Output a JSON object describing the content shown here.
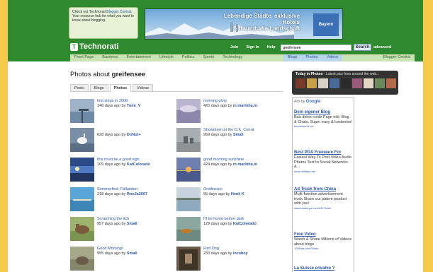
{
  "promo": {
    "pre": "Check out Technorati ",
    "link": "Blogger Central",
    "post": ", Your resource hub for what you want to know about blogging."
  },
  "ad_banner": {
    "line1": "Lebendige Städte, exklusive Hotels",
    "line2": "& traumhafte Landschaft",
    "logo": "Bayern"
  },
  "nav": {
    "logo": "Technorati",
    "links": [
      "Join",
      "Sign In",
      "Help"
    ],
    "search_value": "greifensee",
    "search_button": "Search",
    "advanced": "advanced",
    "categories": [
      "Front Page",
      "Business",
      "Entertainment",
      "Lifestyle",
      "Politics",
      "Sports",
      "Technology"
    ],
    "sections": [
      "Blogs",
      "Photos",
      "Videos"
    ],
    "blogger_central": "Blogger Central"
  },
  "page": {
    "title_prefix": "Photos about ",
    "title_term": "greifensee"
  },
  "tabs": [
    "Posts",
    "Blogs",
    "Photos",
    "Videos"
  ],
  "photos": [
    {
      "title": "first steps in 2008",
      "meta": "148 days ago by ",
      "author": "Tomi_V"
    },
    {
      "title": "morning glory",
      "meta": "420 days ago by ",
      "author": "m.marinha.m"
    },
    {
      "title": "",
      "meta": "628 days ago by ",
      "author": "DoNut+"
    },
    {
      "title": "Showdown at the O.K. Corral",
      "meta": "959 days ago by ",
      "author": "Small"
    },
    {
      "title": "this must be a good sign",
      "meta": "109 days ago by ",
      "author": "KatColorado"
    },
    {
      "title": "good morning sunshine",
      "meta": "424 days ago by ",
      "author": "m.marinha.m"
    },
    {
      "title": "Sommerfest- Fällanden",
      "meta": "318 days ago by ",
      "author": "RonJa2007"
    },
    {
      "title": "Greifensee",
      "meta": "55 days ago by ",
      "author": "Henk K"
    },
    {
      "title": "Scratching the itch",
      "meta": "957 days ago by ",
      "author": "Small"
    },
    {
      "title": "I'll be home before dark",
      "meta": "129 days ago by ",
      "author": "KatColorado"
    },
    {
      "title": "Good Morning!",
      "meta": "955 days ago by ",
      "author": "Small"
    },
    {
      "title": "Fish Dog",
      "meta": "233 days ago by ",
      "author": "incaboy"
    }
  ],
  "today": {
    "title": "Today in Photos",
    "subtitle": " - Latest pics from around the web..."
  },
  "ads": {
    "label": "Ads by ",
    "brand": "Google",
    "items": [
      {
        "title": "Dein eigener Blog",
        "body": "Bau deine coole Page inkl. Blog & Chats. Super easy & kostenlos!",
        "url": "bloomstreet.net"
      },
      {
        "title": "Best PDA Freeware For",
        "body": "Fastest Way To Post Video Audio Photos Text to Social Networks &...",
        "url": "www.deltapin.net"
      },
      {
        "title": "Ad Truck from China",
        "body": "Multi-function advertisement truck Share our patent product with you!",
        "url": "www.leadergo.com/AD-Truck"
      },
      {
        "title": "Free Video",
        "body": "Watch & Share Millions of Videos about blogs",
        "url": "100links.com/Video"
      },
      {
        "title": "La Suisse envahie ?",
        "body": "",
        "url": ""
      }
    ]
  },
  "colors": {
    "brand_green": "#2f8a2f",
    "link_blue": "#2b55a8",
    "page_bg": "#f6c94a"
  }
}
